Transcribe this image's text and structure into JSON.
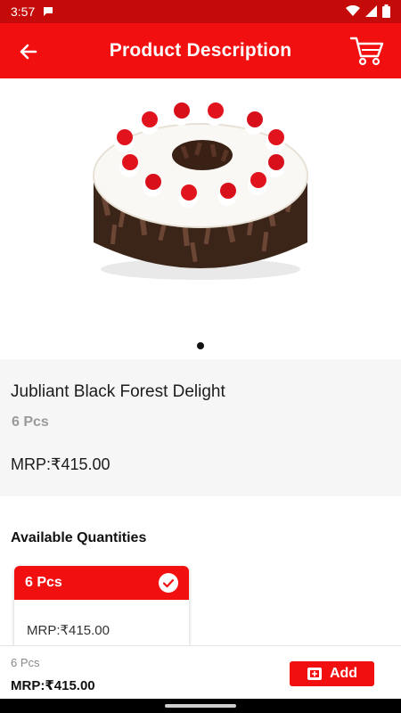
{
  "status_bar": {
    "time": "3:57"
  },
  "app_bar": {
    "title": "Product Description"
  },
  "product": {
    "name": "Jubliant Black Forest Delight",
    "pcs": "6 Pcs",
    "price": "MRP:₹415.00"
  },
  "available_quantities": {
    "title": "Available Quantities",
    "options": [
      {
        "label": "6 Pcs",
        "price": "MRP:₹415.00",
        "selected": true
      }
    ]
  },
  "bottom_bar": {
    "pcs": "6 Pcs",
    "price": "MRP:₹415.00",
    "add_label": "Add"
  },
  "colors": {
    "primary": "#f20f0f",
    "status_bar": "#c50a0a"
  },
  "icons": [
    "back-arrow-icon",
    "cart-icon",
    "check-icon",
    "add-to-cart-icon"
  ]
}
